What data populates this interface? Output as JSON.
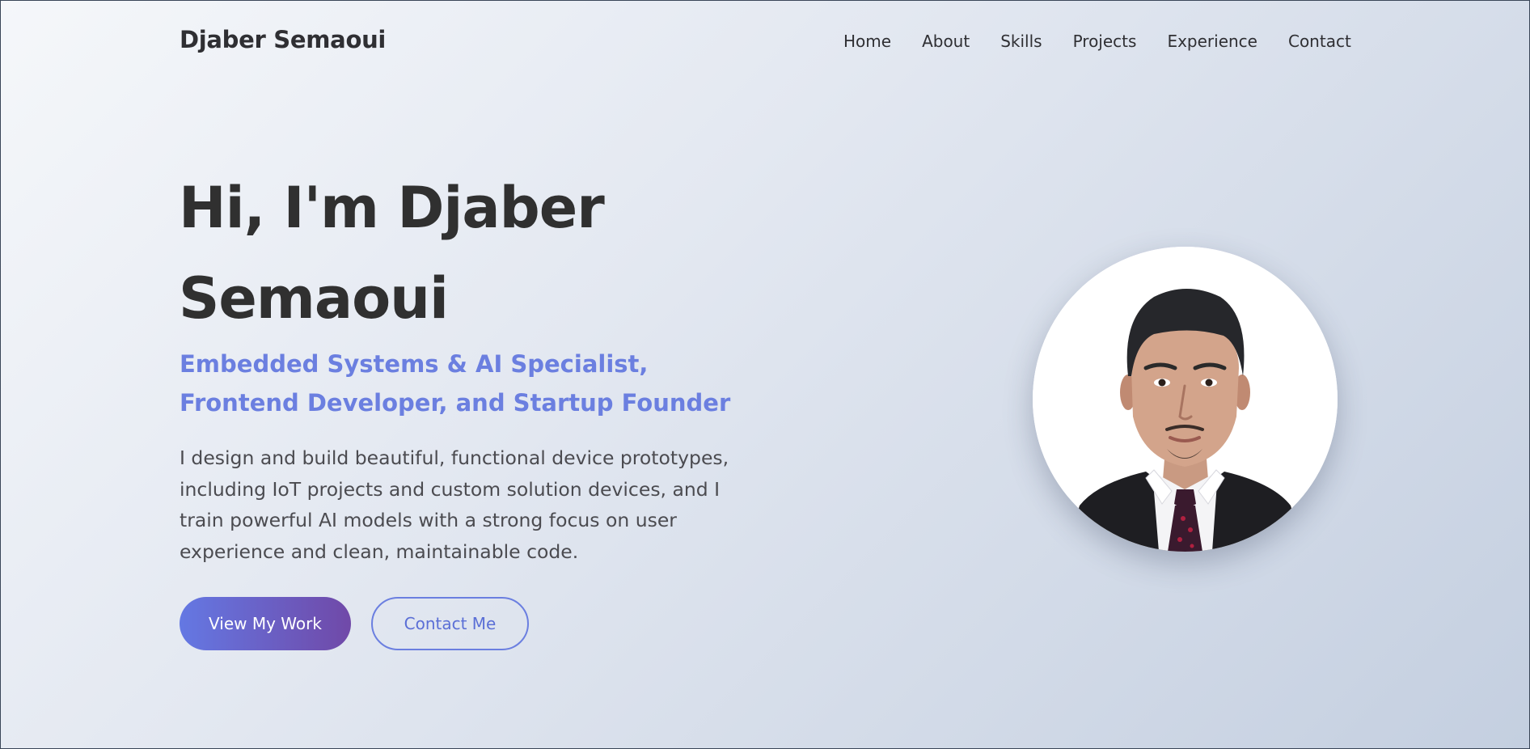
{
  "header": {
    "brand": "Djaber Semaoui",
    "nav": [
      "Home",
      "About",
      "Skills",
      "Projects",
      "Experience",
      "Contact"
    ]
  },
  "hero": {
    "title_line1": "Hi, I'm Djaber",
    "title_line2": "Semaoui",
    "subtitle": "Embedded Systems & AI Specialist, Frontend Developer, and Startup Founder",
    "description": "I design and build beautiful, functional device prototypes, including IoT projects and custom solution devices, and I train powerful AI models with a strong focus on user experience and clean, maintainable code.",
    "primary_button": "View My Work",
    "secondary_button": "Contact Me"
  },
  "colors": {
    "accent": "#6b7fe0",
    "gradient_start": "#6478e3",
    "gradient_end": "#7049a8",
    "text_dark": "#303030",
    "text_body": "#4b4b50"
  }
}
